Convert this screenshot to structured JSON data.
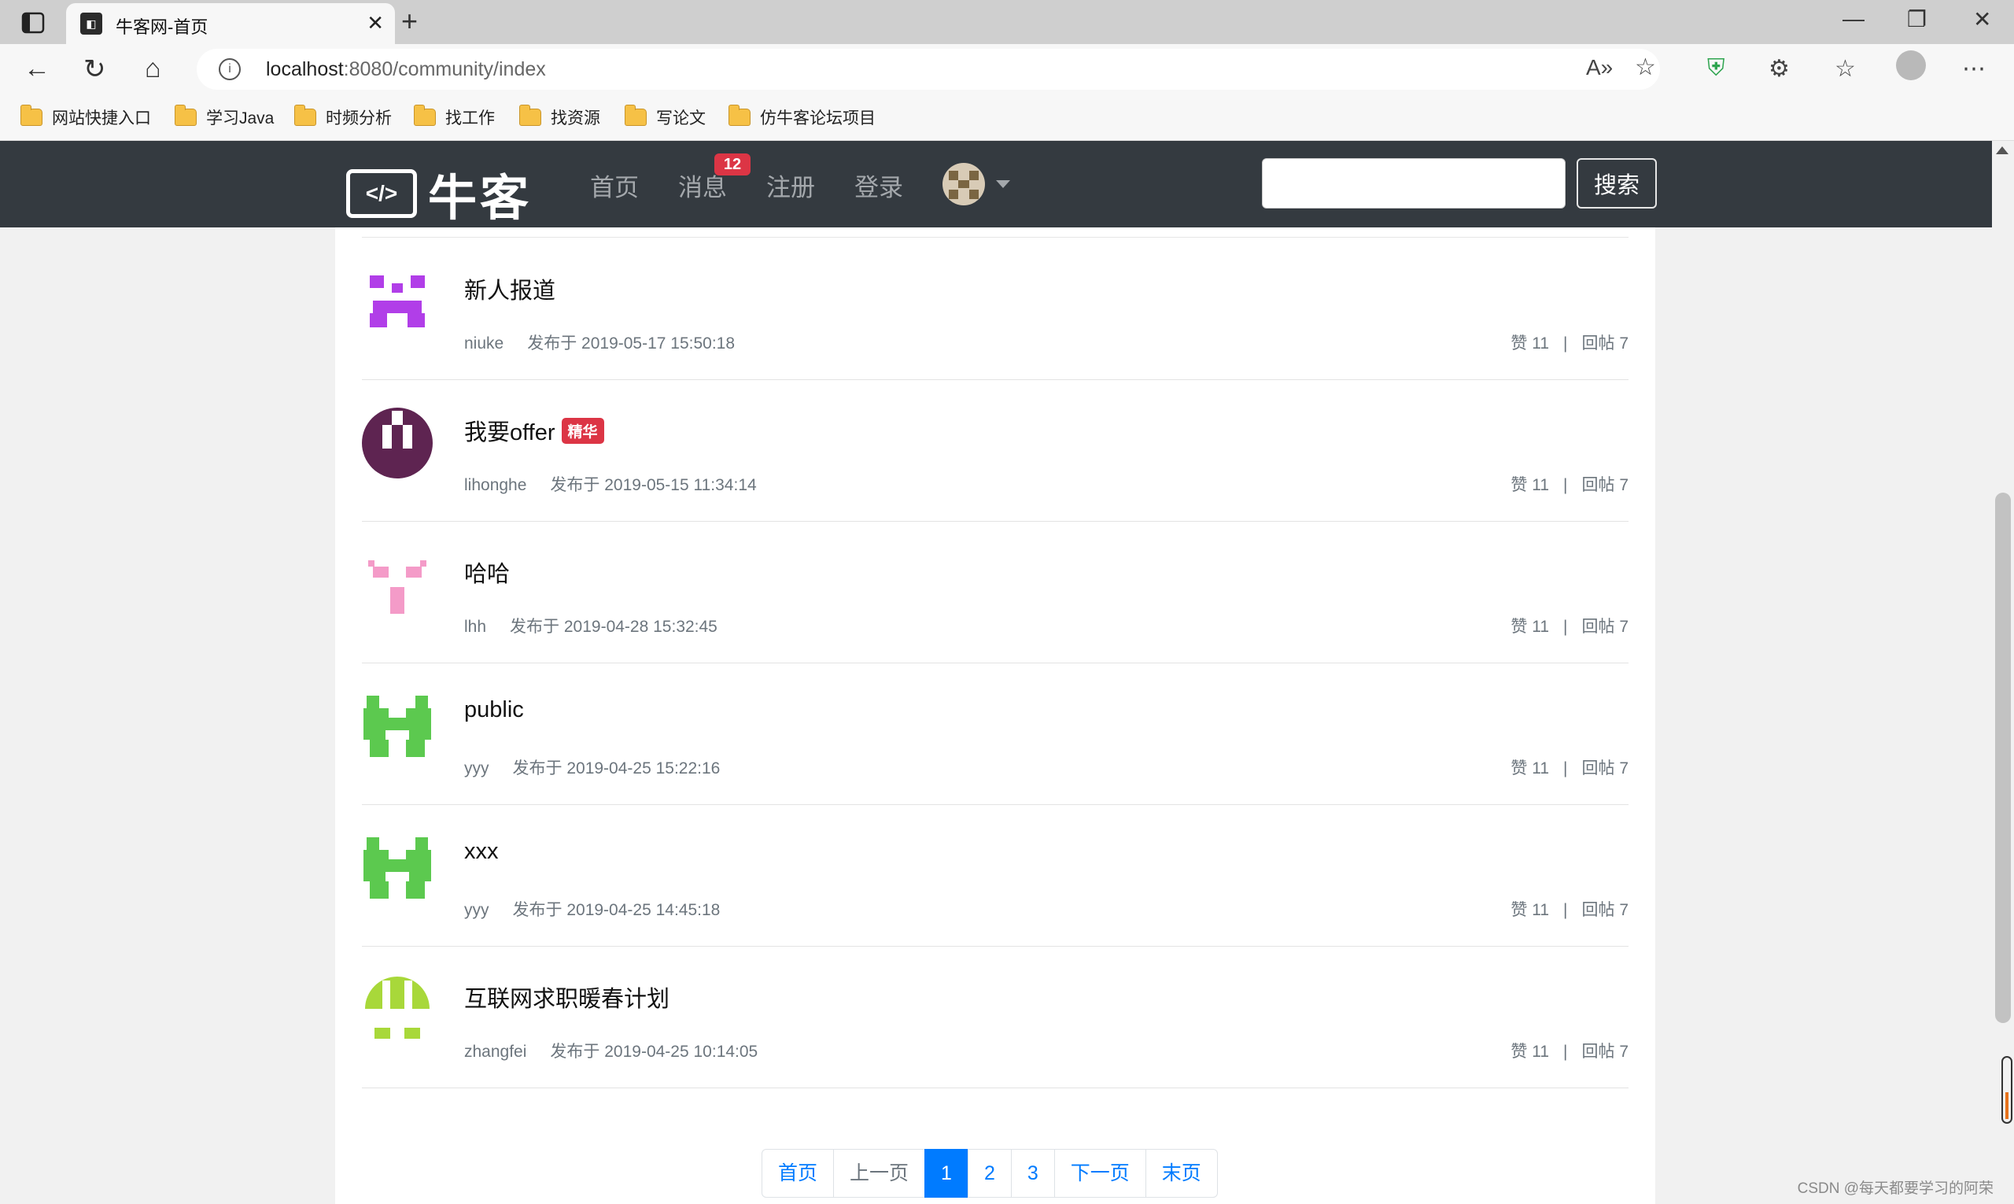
{
  "browser": {
    "tab_title": "牛客网-首页",
    "url_host": "localhost",
    "url_rest": ":8080/community/index",
    "bookmarks": [
      "网站快捷入口",
      "学习Java",
      "时频分析",
      "找工作",
      "找资源",
      "写论文",
      "仿牛客论坛项目"
    ]
  },
  "site": {
    "logo_text": "牛客",
    "nav": {
      "home": "首页",
      "messages": "消息",
      "messages_count": "12",
      "register": "注册",
      "login": "登录"
    },
    "search": {
      "value": "",
      "button": "搜索"
    }
  },
  "posts": [
    {
      "title": "新人报道",
      "author": "niuke",
      "time": "发布于 2019-05-17 15:50:18",
      "likes": "赞 11",
      "replies": "回帖 7",
      "avatar_color": "#b13ee8",
      "featured": false
    },
    {
      "title": "我要offer",
      "badge": "精华",
      "author": "lihonghe",
      "time": "发布于 2019-05-15 11:34:14",
      "likes": "赞 11",
      "replies": "回帖 7",
      "avatar_color": "#5e2451",
      "featured": true
    },
    {
      "title": "哈哈",
      "author": "lhh",
      "time": "发布于 2019-04-28 15:32:45",
      "likes": "赞 11",
      "replies": "回帖 7",
      "avatar_color": "#f49bc8",
      "featured": false
    },
    {
      "title": "public",
      "author": "yyy",
      "time": "发布于 2019-04-25 15:22:16",
      "likes": "赞 11",
      "replies": "回帖 7",
      "avatar_color": "#5cc94f",
      "featured": false
    },
    {
      "title": "xxx",
      "author": "yyy",
      "time": "发布于 2019-04-25 14:45:18",
      "likes": "赞 11",
      "replies": "回帖 7",
      "avatar_color": "#5cc94f",
      "featured": false
    },
    {
      "title": "互联网求职暖春计划",
      "author": "zhangfei",
      "time": "发布于 2019-04-25 10:14:05",
      "likes": "赞 11",
      "replies": "回帖 7",
      "avatar_color": "#a8d83a",
      "featured": false
    }
  ],
  "pagination": {
    "first": "首页",
    "prev": "上一页",
    "pages": [
      "1",
      "2",
      "3"
    ],
    "current": "1",
    "next": "下一页",
    "last": "末页"
  },
  "watermark": "CSDN @每天都要学习的阿荣"
}
